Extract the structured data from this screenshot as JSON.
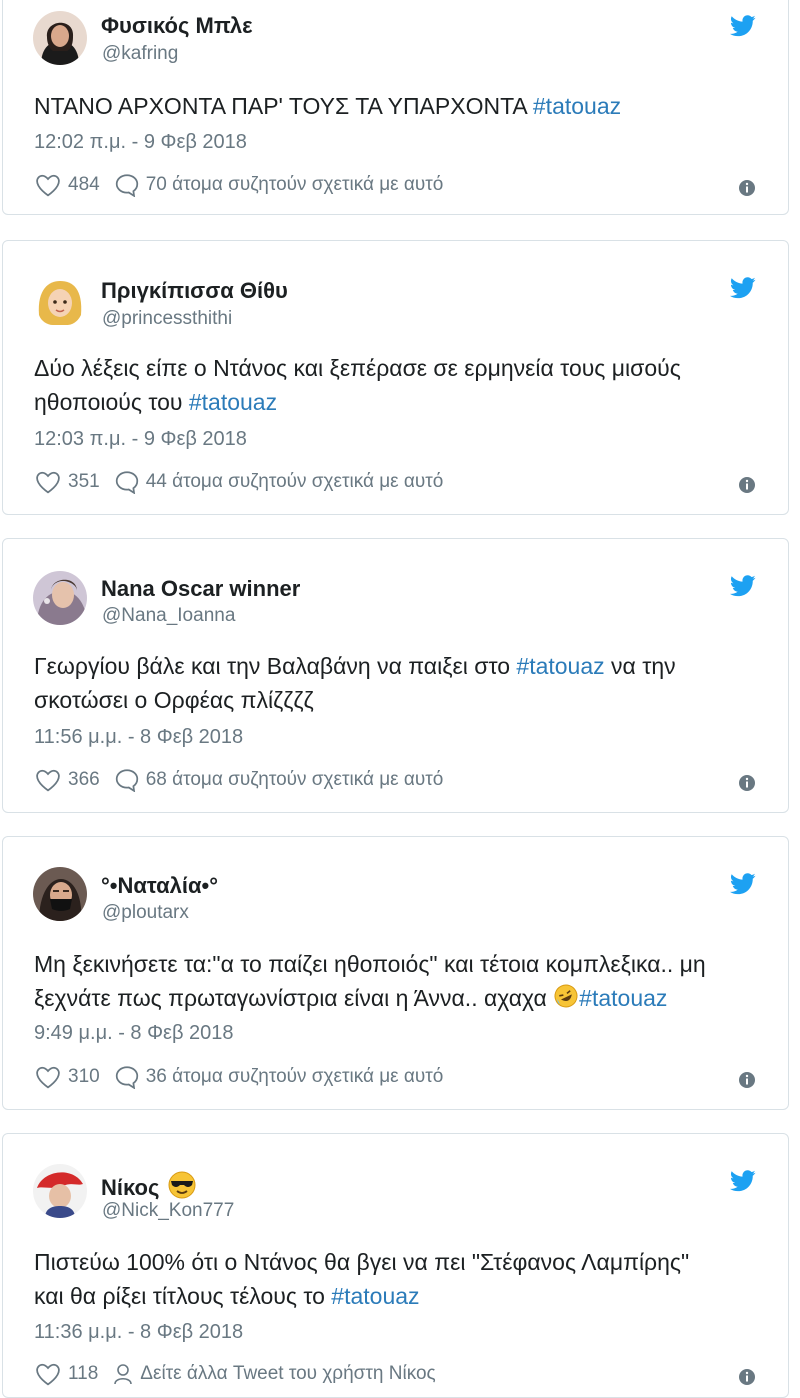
{
  "tweets": [
    {
      "display_name": "Φυσικός Μπλε",
      "handle": "@kafring",
      "text_before": "ΝΤΑΝΟ ΑΡΧΟΝΤΑ ΠΑΡ' ΤΟΥΣ ΤΑ ΥΠΑΡΧΟΝΤΑ ",
      "hashtag": "#tatouaz",
      "timestamp": "12:02 π.μ. - 9 Φεβ 2018",
      "likes": "484",
      "replies": "70 άτομα συζητούν σχετικά με αυτό"
    },
    {
      "display_name": "Πριγκίπισσα Θίθυ",
      "handle": "@princessthithi",
      "text_line1": "Δύο λέξεις είπε ο Ντάνος και ξεπέρασε σε ερμηνεία τους μισούς",
      "text_line2_before": "ηθοποιούς του ",
      "hashtag": "#tatouaz",
      "timestamp": "12:03 π.μ. - 9 Φεβ 2018",
      "likes": "351",
      "replies": "44 άτομα συζητούν σχετικά με αυτό"
    },
    {
      "display_name": "Nana Oscar winner",
      "handle": "@Nana_Ioanna",
      "text_line1_before": "Γεωργίου βάλε και την Βαλαβάνη να παιξει στο ",
      "hashtag": "#tatouaz",
      "text_line1_after": " να την",
      "text_line2": "σκοτώσει ο Ορφέας πλίζζζζ",
      "timestamp": "11:56 μ.μ. - 8 Φεβ 2018",
      "likes": "366",
      "replies": "68 άτομα συζητούν σχετικά με αυτό"
    },
    {
      "display_name": "°•Ναταλία•°",
      "handle": "@ploutarx",
      "text_line1": "Μη ξεκινήσετε τα:\"α το παίζει ηθοποιός\" και τέτοια κομπλεξικα.. μη",
      "text_line2_before": "ξεχνάτε πως πρωταγωνίστρια είναι η Άννα.. αχαχα ",
      "hashtag": "#tatouaz",
      "timestamp": "9:49 μ.μ. - 8 Φεβ 2018",
      "likes": "310",
      "replies": "36 άτομα συζητούν σχετικά με αυτό"
    },
    {
      "display_name": "Νίκος",
      "handle": "@Nick_Kon777",
      "text_line1": "Πιστεύω 100% ότι ο Ντάνος θα βγει να πει \"Στέφανος Λαμπίρης\"",
      "text_line2_before": "και θα ρίξει τίτλους τέλους το ",
      "hashtag": "#tatouaz",
      "timestamp": "11:36 μ.μ. - 8 Φεβ 2018",
      "likes": "118",
      "replies": "Δείτε άλλα Tweet του χρήστη Νίκος"
    }
  ],
  "icons": {
    "bird": "twitter-bird-icon",
    "heart": "heart-icon",
    "reply": "speech-bubble-icon",
    "info": "info-icon",
    "person": "person-icon"
  },
  "colors": {
    "hashtag": "#2b7bb9",
    "bird": "#1da1f2",
    "muted": "#697882",
    "border": "#d9e1e6"
  }
}
